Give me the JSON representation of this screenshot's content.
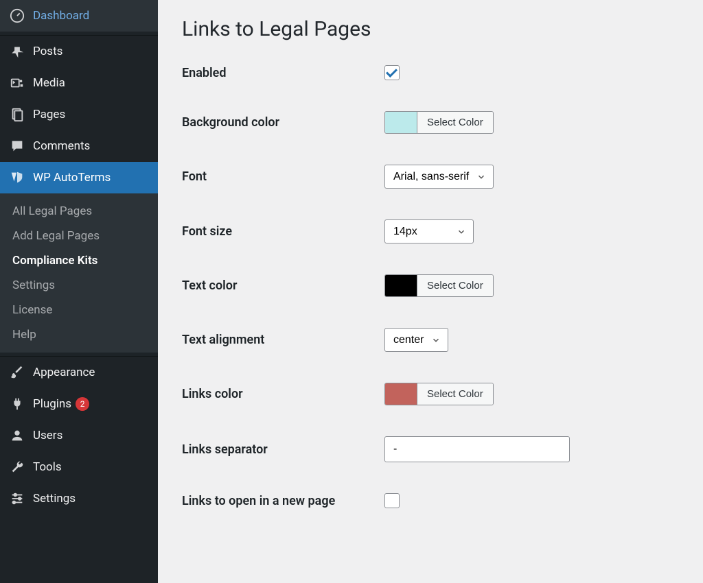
{
  "sidebar": {
    "items": [
      {
        "label": "Dashboard",
        "icon": "dashboard-icon"
      },
      {
        "label": "Posts",
        "icon": "pin-icon"
      },
      {
        "label": "Media",
        "icon": "media-icon"
      },
      {
        "label": "Pages",
        "icon": "pages-icon"
      },
      {
        "label": "Comments",
        "icon": "comments-icon"
      },
      {
        "label": "WP AutoTerms",
        "icon": "autoterms-icon"
      },
      {
        "label": "Appearance",
        "icon": "brush-icon"
      },
      {
        "label": "Plugins",
        "icon": "plug-icon"
      },
      {
        "label": "Users",
        "icon": "user-icon"
      },
      {
        "label": "Tools",
        "icon": "wrench-icon"
      },
      {
        "label": "Settings",
        "icon": "sliders-icon"
      }
    ],
    "submenu": [
      {
        "label": "All Legal Pages"
      },
      {
        "label": "Add Legal Pages"
      },
      {
        "label": "Compliance Kits"
      },
      {
        "label": "Settings"
      },
      {
        "label": "License"
      },
      {
        "label": "Help"
      }
    ],
    "plugins_badge": "2"
  },
  "page": {
    "title": "Links to Legal Pages",
    "fields": {
      "enabled": {
        "label": "Enabled"
      },
      "bg_color": {
        "label": "Background color",
        "swatch": "#bceaeb",
        "button": "Select Color"
      },
      "font": {
        "label": "Font",
        "value": "Arial, sans-serif"
      },
      "font_size": {
        "label": "Font size",
        "value": "14px"
      },
      "text_color": {
        "label": "Text color",
        "swatch": "#000000",
        "button": "Select Color"
      },
      "text_align": {
        "label": "Text alignment",
        "value": "center"
      },
      "links_color": {
        "label": "Links color",
        "swatch": "#c2635c",
        "button": "Select Color"
      },
      "links_sep": {
        "label": "Links separator",
        "value": "-"
      },
      "links_new_page": {
        "label": "Links to open in a new page"
      }
    }
  }
}
